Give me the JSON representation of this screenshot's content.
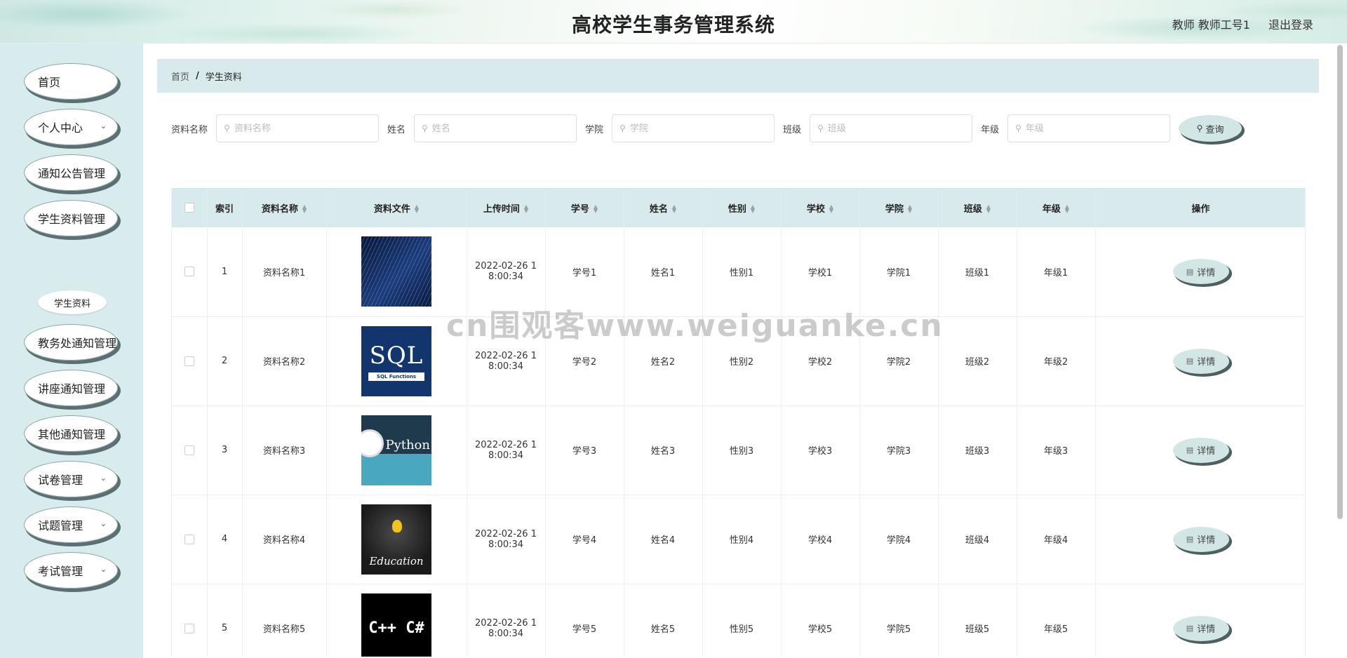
{
  "header": {
    "title": "高校学生事务管理系统",
    "user": "教师 教师工号1",
    "logout": "退出登录"
  },
  "sidebar": {
    "items": [
      {
        "label": "首页",
        "has_children": false
      },
      {
        "label": "个人中心",
        "has_children": true
      },
      {
        "label": "通知公告管理",
        "has_children": false
      },
      {
        "label": "学生资料管理",
        "has_children": false
      },
      {
        "label": "教务处通知管理",
        "has_children": false
      },
      {
        "label": "讲座通知管理",
        "has_children": false
      },
      {
        "label": "其他通知管理",
        "has_children": false
      },
      {
        "label": "试卷管理",
        "has_children": true
      },
      {
        "label": "试题管理",
        "has_children": true
      },
      {
        "label": "考试管理",
        "has_children": true
      }
    ],
    "sub_item": "学生资料"
  },
  "breadcrumb": {
    "home": "首页",
    "separator": "/",
    "current": "学生资料"
  },
  "search": {
    "fields": [
      {
        "label": "资料名称",
        "placeholder": "资料名称"
      },
      {
        "label": "姓名",
        "placeholder": "姓名"
      },
      {
        "label": "学院",
        "placeholder": "学院"
      },
      {
        "label": "班级",
        "placeholder": "班级"
      },
      {
        "label": "年级",
        "placeholder": "年级"
      }
    ],
    "button": "查询"
  },
  "table": {
    "columns": [
      "索引",
      "资料名称",
      "资料文件",
      "上传时间",
      "学号",
      "姓名",
      "性别",
      "学校",
      "学院",
      "班级",
      "年级",
      "操作"
    ],
    "rows": [
      {
        "index": "1",
        "name": "资料名称1",
        "file": "code-image",
        "time_line1": "2022-02-26 1",
        "time_line2": "8:00:34",
        "student_no": "学号1",
        "student_name": "姓名1",
        "gender": "性别1",
        "school": "学校1",
        "college": "学院1",
        "class": "班级1",
        "grade": "年级1",
        "action": "详情"
      },
      {
        "index": "2",
        "name": "资料名称2",
        "file": "sql-image",
        "file_text": "SQL",
        "file_subtext": "SQL Functions",
        "time_line1": "2022-02-26 1",
        "time_line2": "8:00:34",
        "student_no": "学号2",
        "student_name": "姓名2",
        "gender": "性别2",
        "school": "学校2",
        "college": "学院2",
        "class": "班级2",
        "grade": "年级2",
        "action": "详情"
      },
      {
        "index": "3",
        "name": "资料名称3",
        "file": "python-image",
        "file_text": "Python",
        "time_line1": "2022-02-26 1",
        "time_line2": "8:00:34",
        "student_no": "学号3",
        "student_name": "姓名3",
        "gender": "性别3",
        "school": "学校3",
        "college": "学院3",
        "class": "班级3",
        "grade": "年级3",
        "action": "详情"
      },
      {
        "index": "4",
        "name": "资料名称4",
        "file": "education-image",
        "file_text": "Education",
        "time_line1": "2022-02-26 1",
        "time_line2": "8:00:34",
        "student_no": "学号4",
        "student_name": "姓名4",
        "gender": "性别4",
        "school": "学校4",
        "college": "学院4",
        "class": "班级4",
        "grade": "年级4",
        "action": "详情"
      },
      {
        "index": "5",
        "name": "资料名称5",
        "file": "cpp-image",
        "file_text": "C++ C#",
        "time_line1": "2022-02-26 1",
        "time_line2": "8:00:34",
        "student_no": "学号5",
        "student_name": "姓名5",
        "gender": "性别5",
        "school": "学校5",
        "college": "学院5",
        "class": "班级5",
        "grade": "年级5",
        "action": "详情"
      }
    ]
  },
  "watermark": "cn围观客www.weiguanke.cn"
}
